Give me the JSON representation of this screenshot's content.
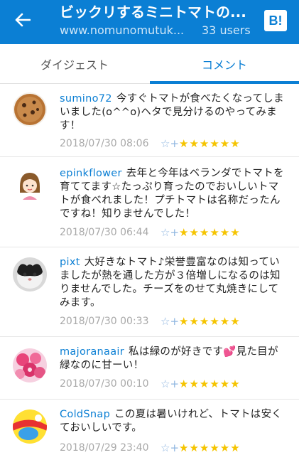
{
  "header": {
    "title": "ビックリするミニトマトの...",
    "domain": "www.nomunomutuk...",
    "users": "33 users",
    "logo_text": "B!"
  },
  "tabs": [
    {
      "label": "ダイジェスト",
      "active": false
    },
    {
      "label": "コメント",
      "active": true
    }
  ],
  "comments": [
    {
      "username": "sumino72",
      "text": "今すぐトマトが食べたくなってしまいました(o^^o)ヘタで見分けるのやってみます！",
      "timestamp": "2018/07/30 08:06",
      "stars": "★★★★★★"
    },
    {
      "username": "epinkflower",
      "text": "去年と今年はベランダでトマトを育ててます☆たっぷり育ったのでおいしいトマトが食べれました！プチトマトは名称だったんですね！知りませんでした！",
      "timestamp": "2018/07/30 06:44",
      "stars": "★★★★★★"
    },
    {
      "username": "pixt",
      "text": "大好きなトマト♪栄誉豊富なのは知っていましたが熱を通した方が３倍増しになるのは知りませんでした。チーズをのせて丸焼きにしてみます。",
      "timestamp": "2018/07/30 00:33",
      "stars": "★★★★★★"
    },
    {
      "username": "majoranaair",
      "text": "私は緑のが好きです💕見た目が緑なのに甘ーい！",
      "timestamp": "2018/07/30 00:10",
      "stars": "★★★★★★"
    },
    {
      "username": "ColdSnap",
      "text": "この夏は暑いけれど、トマトは安くておいしいです。",
      "timestamp": "2018/07/29 23:40",
      "stars": "★★★★★★"
    }
  ],
  "colors": {
    "accent": "#0b7fd4",
    "star": "#f5c400"
  }
}
